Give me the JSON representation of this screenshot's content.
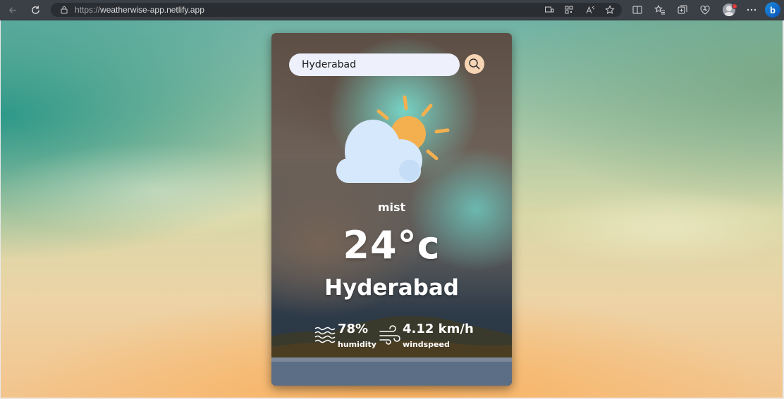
{
  "browser": {
    "url_host": "https://",
    "url_domain": "weatherwise-app.netlify.app",
    "bing_label": "b"
  },
  "weather": {
    "search": {
      "value": "Hyderabad",
      "placeholder": ""
    },
    "description": "mist",
    "temperature": "24°c",
    "city": "Hyderabad",
    "humidity": {
      "value": "78%",
      "label": "humidity"
    },
    "wind": {
      "value": "4.12 km/h",
      "label": "windspeed"
    }
  },
  "colors": {
    "search_bg": "#eef0fb",
    "search_button_bg": "#f6d4b4",
    "sun": "#f4b04f",
    "cloud": "#d6e8fb"
  }
}
